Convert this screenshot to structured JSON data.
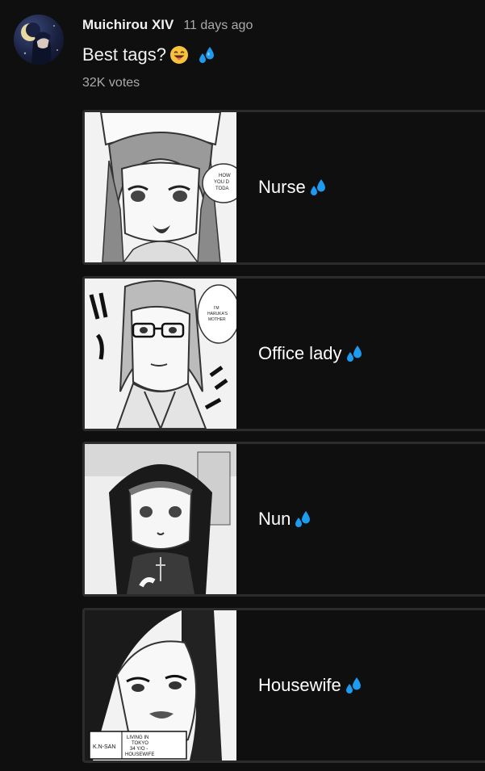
{
  "post": {
    "author": "Muichirou XIV",
    "time_ago": "11 days ago",
    "text": "Best tags?",
    "text_icons": [
      "grinning-tongue-emoji",
      "sweat-droplets-icon"
    ],
    "votes": "32K votes"
  },
  "poll": {
    "options": [
      {
        "label": "Nurse",
        "icon": "sweat-droplets-icon",
        "image_text": "HOW YOU D TODA"
      },
      {
        "label": "Office lady",
        "icon": "sweat-droplets-icon",
        "image_text": "I'M HARUKA'S MOTHER"
      },
      {
        "label": "Nun",
        "icon": "sweat-droplets-icon",
        "image_text": ""
      },
      {
        "label": "Housewife",
        "icon": "sweat-droplets-icon",
        "image_text": "K.N-SAN LIVING IN TOKYO 34 Y/O - HOUSEWIFE"
      }
    ]
  },
  "colors": {
    "background": "#0f0f0f",
    "text_primary": "#f1f1f1",
    "text_secondary": "#aaaaaa",
    "option_border": "#2c2c2c",
    "sweat_blue": "#1d9bf0",
    "emoji_yellow": "#f9c23c"
  }
}
